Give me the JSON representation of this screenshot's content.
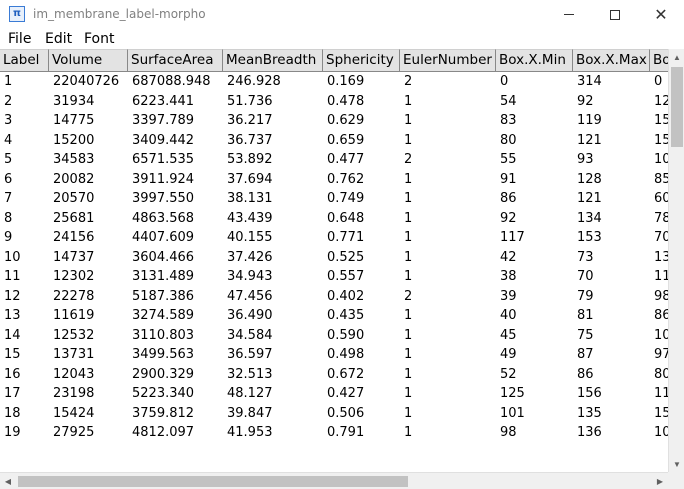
{
  "window": {
    "title": "im_membrane_label-morpho",
    "icon": "image-j-icon",
    "icon_glyph": "π",
    "controls": {
      "minimize_icon": "minimize-icon",
      "maximize_icon": "maximize-icon",
      "close_icon": "close-icon",
      "close_glyph": "✕"
    }
  },
  "menu": [
    "File",
    "Edit",
    "Font"
  ],
  "table": {
    "columns": [
      "Label",
      "Volume",
      "SurfaceArea",
      "MeanBreadth",
      "Sphericity",
      "EulerNumber",
      "Box.X.Min",
      "Box.X.Max",
      "Bo"
    ],
    "rows": [
      [
        "1",
        "22040726",
        "687088.948",
        "246.928",
        "0.169",
        "2",
        "0",
        "314",
        "0"
      ],
      [
        "2",
        "31934",
        "6223.441",
        "51.736",
        "0.478",
        "1",
        "54",
        "92",
        "12"
      ],
      [
        "3",
        "14775",
        "3397.789",
        "36.217",
        "0.629",
        "1",
        "83",
        "119",
        "15"
      ],
      [
        "4",
        "15200",
        "3409.442",
        "36.737",
        "0.659",
        "1",
        "80",
        "121",
        "15"
      ],
      [
        "5",
        "34583",
        "6571.535",
        "53.892",
        "0.477",
        "2",
        "55",
        "93",
        "10"
      ],
      [
        "6",
        "20082",
        "3911.924",
        "37.694",
        "0.762",
        "1",
        "91",
        "128",
        "85"
      ],
      [
        "7",
        "20570",
        "3997.550",
        "38.131",
        "0.749",
        "1",
        "86",
        "121",
        "60"
      ],
      [
        "8",
        "25681",
        "4863.568",
        "43.439",
        "0.648",
        "1",
        "92",
        "134",
        "78"
      ],
      [
        "9",
        "24156",
        "4407.609",
        "40.155",
        "0.771",
        "1",
        "117",
        "153",
        "70"
      ],
      [
        "10",
        "14737",
        "3604.466",
        "37.426",
        "0.525",
        "1",
        "42",
        "73",
        "13"
      ],
      [
        "11",
        "12302",
        "3131.489",
        "34.943",
        "0.557",
        "1",
        "38",
        "70",
        "11"
      ],
      [
        "12",
        "22278",
        "5187.386",
        "47.456",
        "0.402",
        "2",
        "39",
        "79",
        "98"
      ],
      [
        "13",
        "11619",
        "3274.589",
        "36.490",
        "0.435",
        "1",
        "40",
        "81",
        "86"
      ],
      [
        "14",
        "12532",
        "3110.803",
        "34.584",
        "0.590",
        "1",
        "45",
        "75",
        "10"
      ],
      [
        "15",
        "13731",
        "3499.563",
        "36.597",
        "0.498",
        "1",
        "49",
        "87",
        "97"
      ],
      [
        "16",
        "12043",
        "2900.329",
        "32.513",
        "0.672",
        "1",
        "52",
        "86",
        "80"
      ],
      [
        "17",
        "23198",
        "5223.340",
        "48.127",
        "0.427",
        "1",
        "125",
        "156",
        "11"
      ],
      [
        "18",
        "15424",
        "3759.812",
        "39.847",
        "0.506",
        "1",
        "101",
        "135",
        "15"
      ],
      [
        "19",
        "27925",
        "4812.097",
        "41.953",
        "0.791",
        "1",
        "98",
        "136",
        "10"
      ]
    ]
  },
  "scrollbars": {
    "up_glyph": "▲",
    "down_glyph": "▼",
    "left_glyph": "◀",
    "right_glyph": "▶"
  }
}
